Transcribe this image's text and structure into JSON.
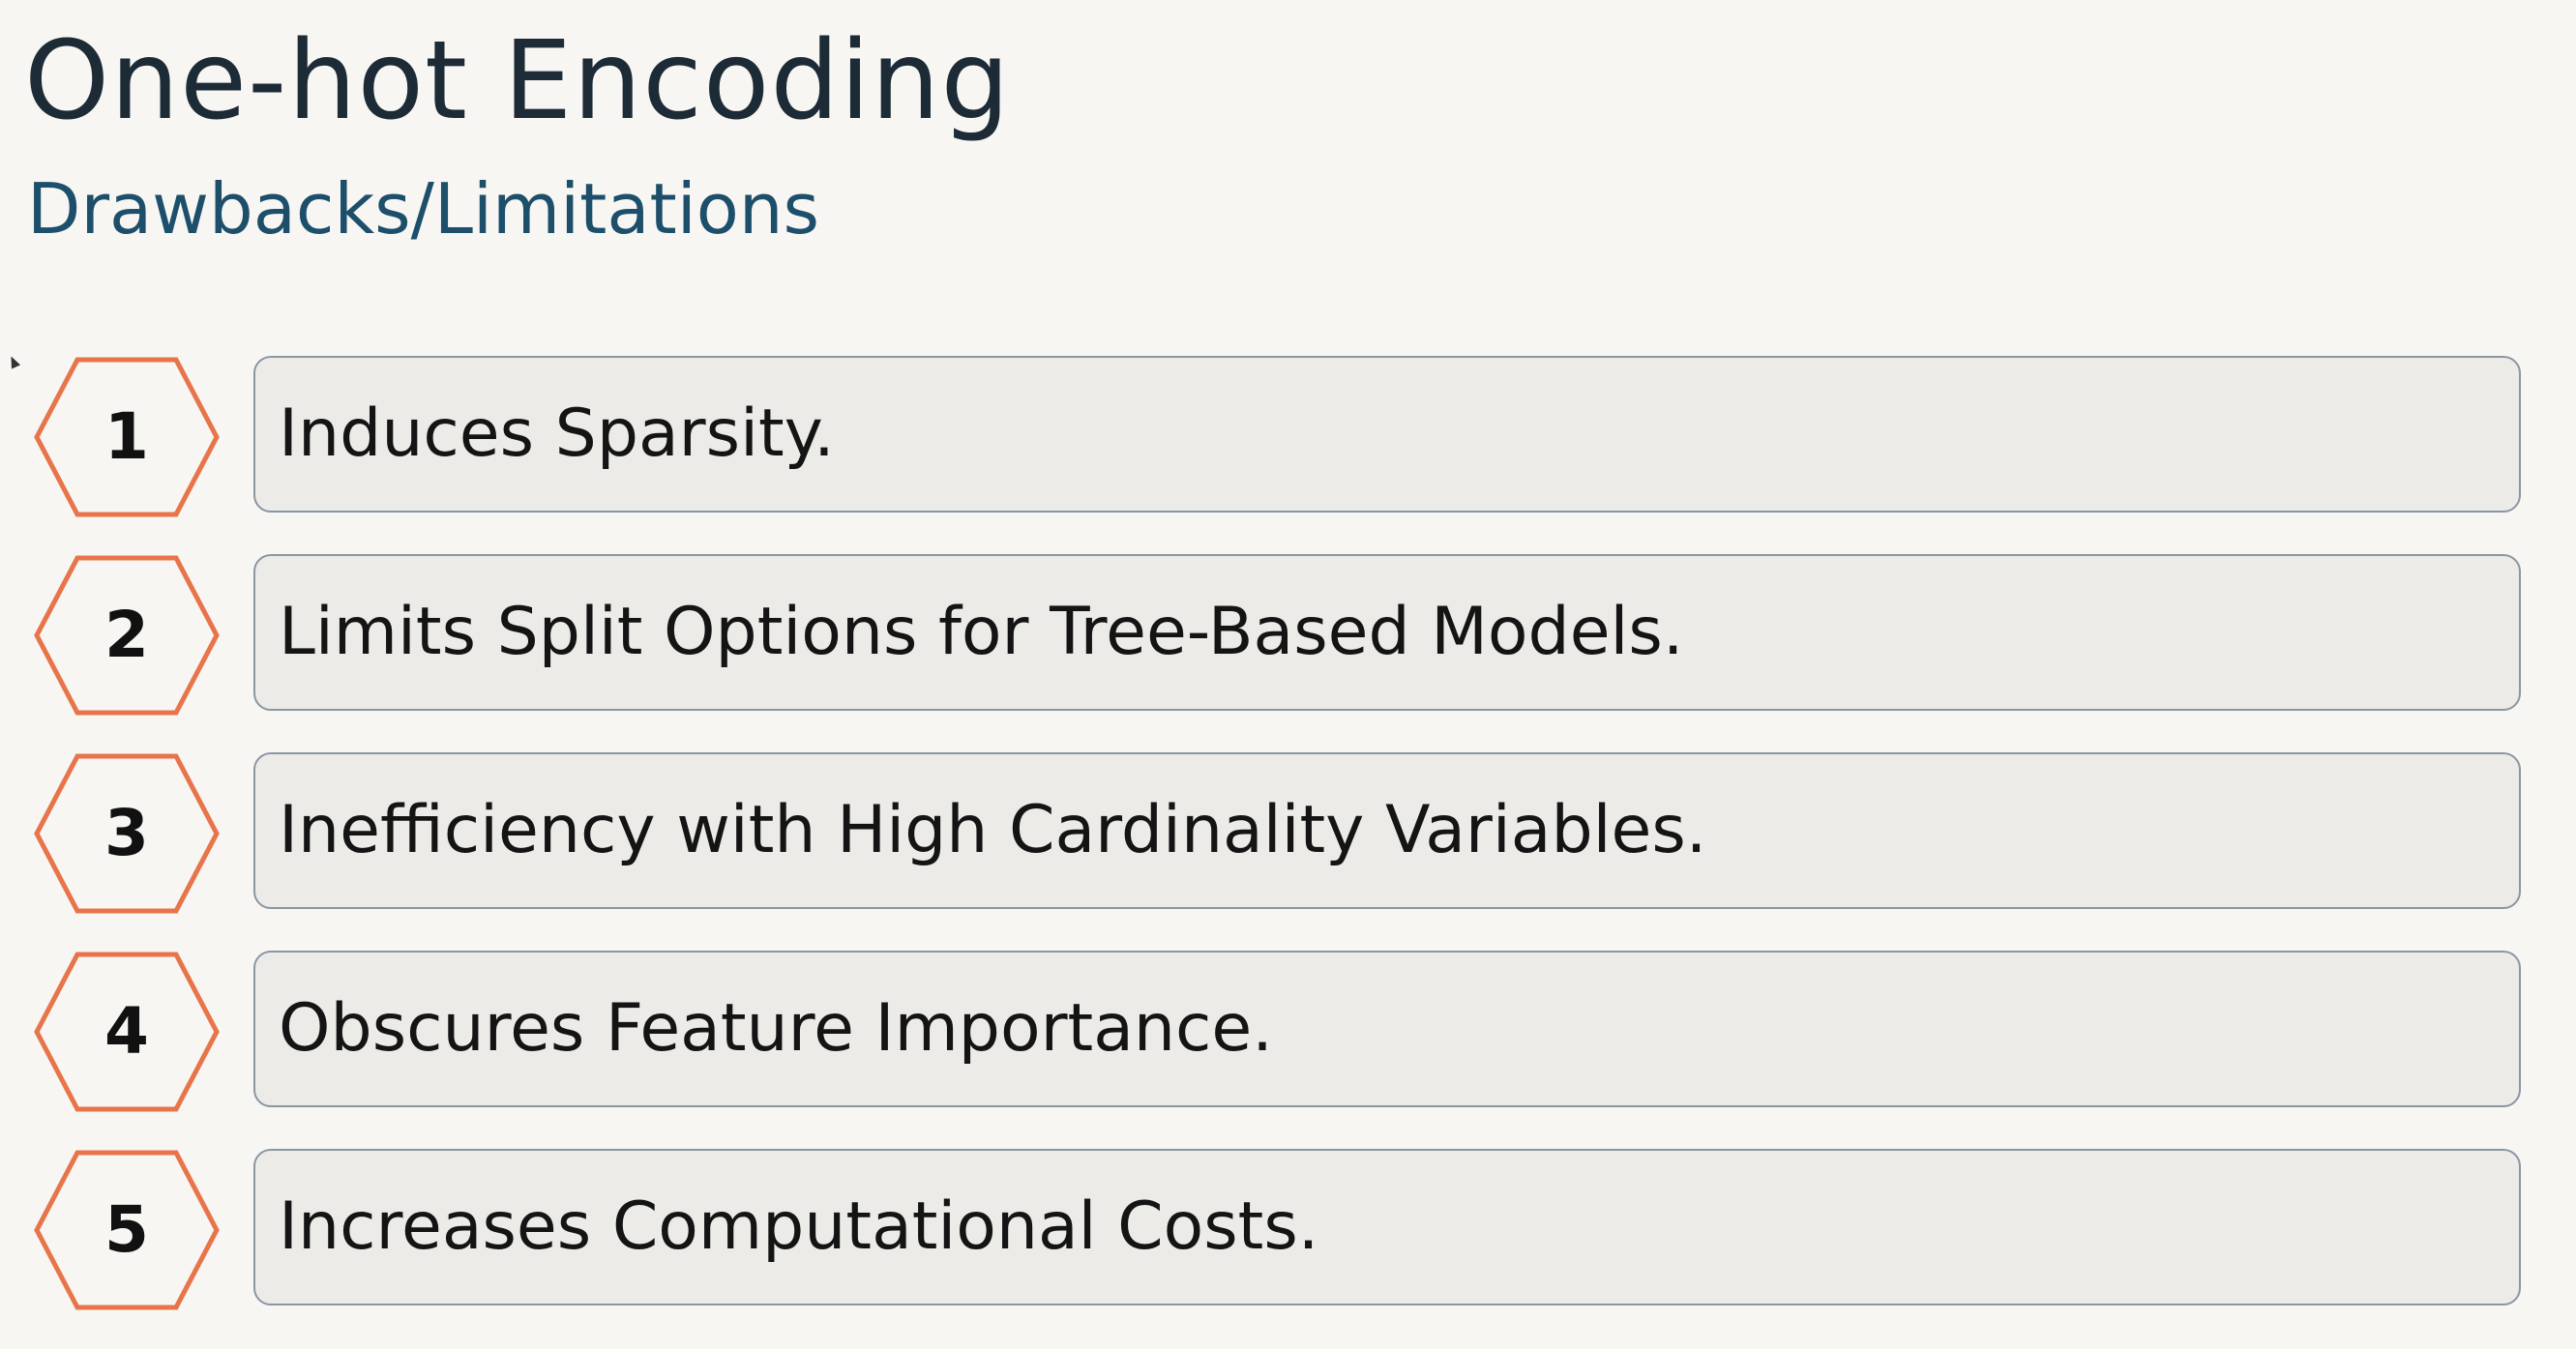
{
  "slide": {
    "title": "One-hot Encoding",
    "subtitle": "Drawbacks/Limitations"
  },
  "colors": {
    "hexagon_stroke": "#e8744a",
    "title": "#1d2b36",
    "subtitle": "#1d4f6b",
    "box_fill": "#ecebe8",
    "box_border": "#8a96a2"
  },
  "items": [
    {
      "number": "1",
      "text": "Induces Sparsity."
    },
    {
      "number": "2",
      "text": "Limits Split Options for Tree-Based Models."
    },
    {
      "number": "3",
      "text": "Inefficiency with High Cardinality Variables."
    },
    {
      "number": "4",
      "text": "Obscures Feature Importance."
    },
    {
      "number": "5",
      "text": "Increases Computational Costs."
    }
  ]
}
